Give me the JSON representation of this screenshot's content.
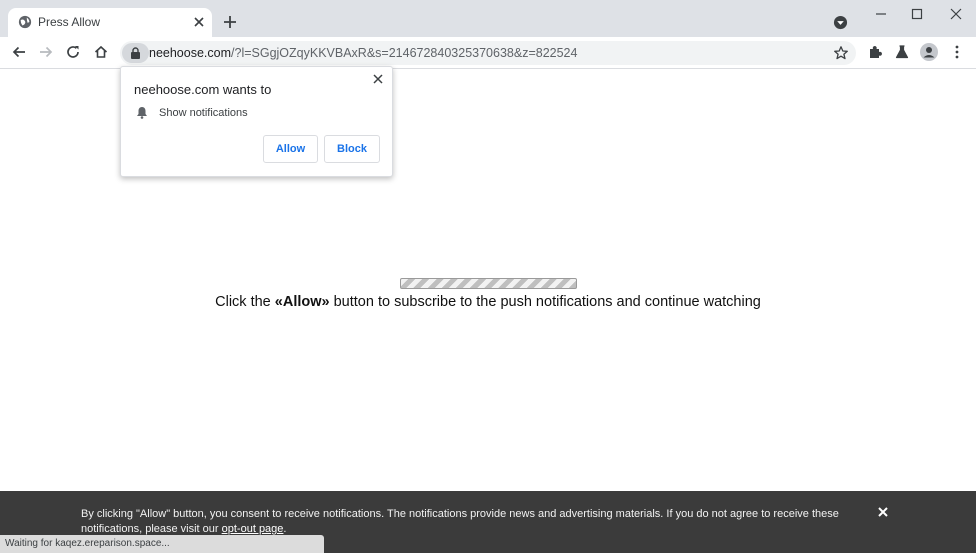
{
  "browser": {
    "tab": {
      "title": "Press Allow"
    },
    "address": {
      "host": "neehoose.com",
      "path": "/?l=SGgjOZqyKKVBAxR&s=214672840325370638&z=822524"
    },
    "icons": [
      "globe-icon",
      "close-icon",
      "plus-icon",
      "profile-dropdown-icon",
      "minimize-icon",
      "maximize-icon",
      "close-window-icon",
      "back-arrow-icon",
      "forward-arrow-icon",
      "reload-icon",
      "home-icon",
      "lock-icon",
      "star-icon",
      "puzzle-icon",
      "flask-icon",
      "avatar-icon",
      "more-vert-icon"
    ]
  },
  "permission_popup": {
    "title": "neehoose.com wants to",
    "permission": "Show notifications",
    "allow_label": "Allow",
    "block_label": "Block"
  },
  "page": {
    "message_before": "Click the ",
    "message_bold": "«Allow»",
    "message_after": " button to subscribe to the push notifications and continue watching"
  },
  "consent_banner": {
    "text": "By clicking \"Allow\" button, you consent to receive notifications. The notifications provide news and advertising materials. If you do not agree to receive these notifications, please visit our ",
    "link_text": "opt-out page",
    "text_end": "."
  },
  "status_bar": {
    "text": "Waiting for kaqez.ereparison.space..."
  }
}
